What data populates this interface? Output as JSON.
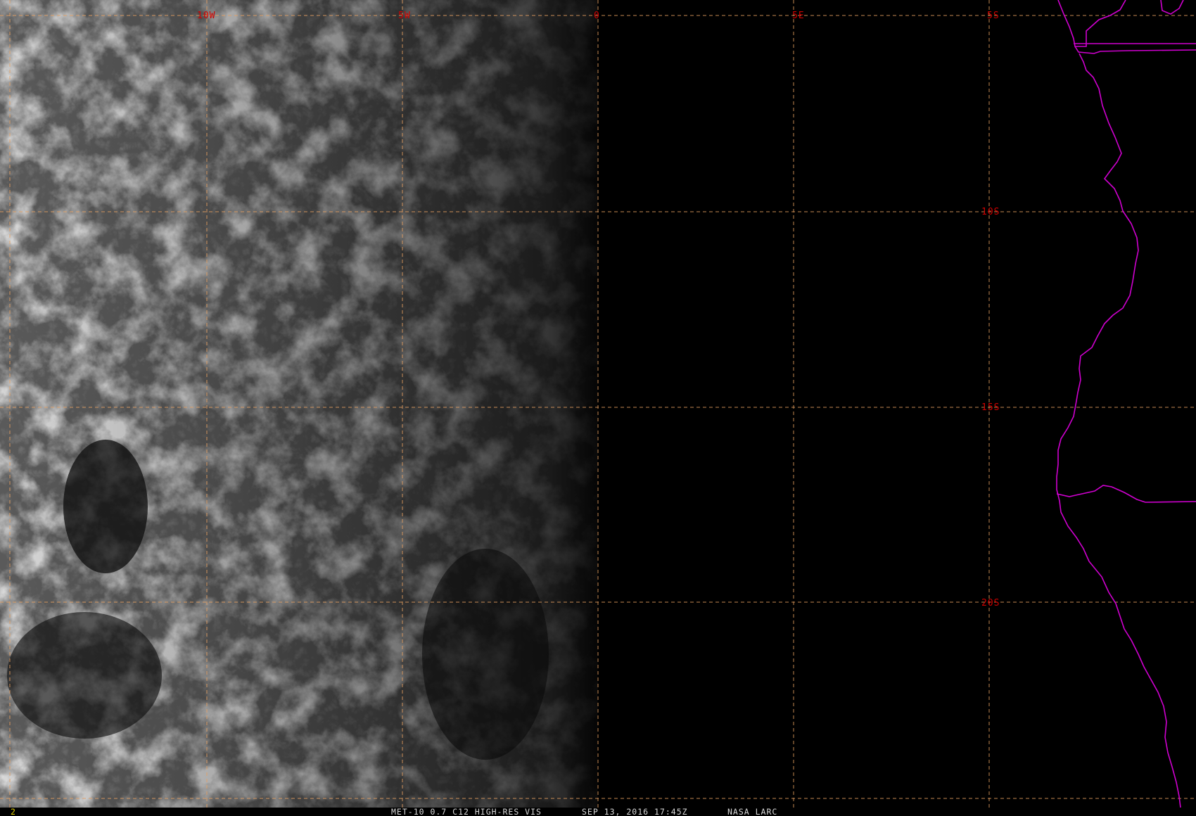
{
  "image": {
    "frame_number": "2",
    "caption": {
      "product": "MET-10 0.7 C12 HIGH-RES VIS",
      "datetime": "SEP 13, 2016 17:45Z",
      "source": "NASA LARC"
    }
  },
  "grid": {
    "longitude_labels": [
      "10W",
      "5W",
      "0",
      "5E"
    ],
    "latitude_labels": [
      "5S",
      "10S",
      "15S",
      "20S"
    ],
    "line_color": "#e8a060",
    "label_color": "#d00000"
  },
  "colors": {
    "background": "#000000",
    "coastline": "#d000d0",
    "caption_text": "#d8d8d8",
    "frame_number_text": "#e0d000"
  },
  "icons": [
    "coastline-boundary",
    "cloud-field"
  ]
}
